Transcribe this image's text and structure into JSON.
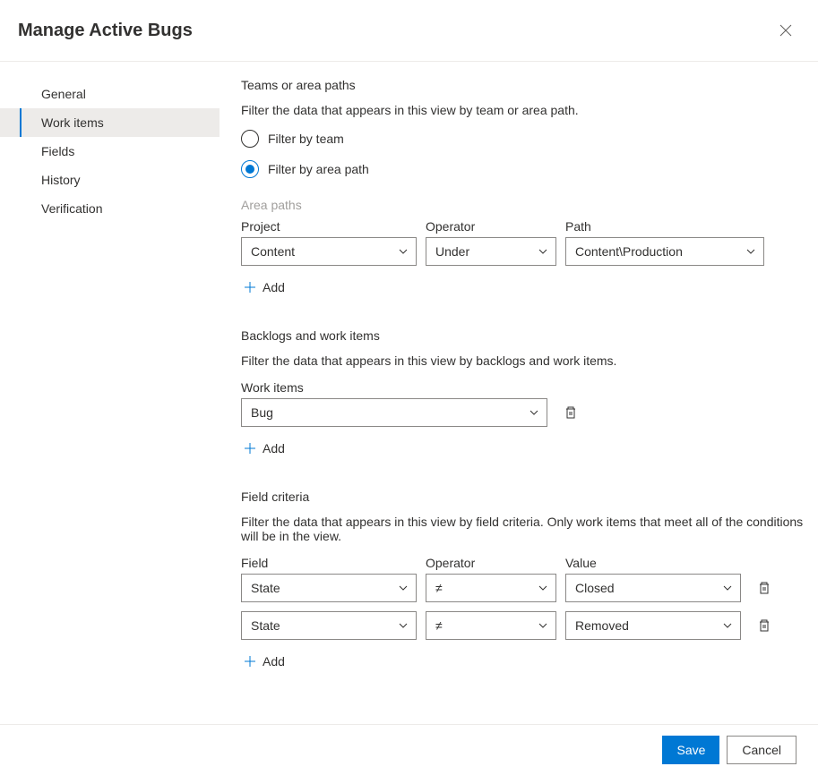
{
  "title": "Manage Active Bugs",
  "sidebar": {
    "items": [
      {
        "label": "General",
        "selected": false
      },
      {
        "label": "Work items",
        "selected": true
      },
      {
        "label": "Fields",
        "selected": false
      },
      {
        "label": "History",
        "selected": false
      },
      {
        "label": "Verification",
        "selected": false
      }
    ]
  },
  "teams_section": {
    "title": "Teams or area paths",
    "desc": "Filter the data that appears in this view by team or area path.",
    "radio_team": "Filter by team",
    "radio_area": "Filter by area path",
    "selected": "area",
    "area_label": "Area paths",
    "project_label": "Project",
    "operator_label": "Operator",
    "path_label": "Path",
    "project_value": "Content",
    "operator_value": "Under",
    "path_value": "Content\\Production",
    "add_label": "Add"
  },
  "backlogs_section": {
    "title": "Backlogs and work items",
    "desc": "Filter the data that appears in this view by backlogs and work items.",
    "work_items_label": "Work items",
    "work_item_value": "Bug",
    "add_label": "Add"
  },
  "criteria_section": {
    "title": "Field criteria",
    "desc": "Filter the data that appears in this view by field criteria. Only work items that meet all of the conditions will be in the view.",
    "field_label": "Field",
    "operator_label": "Operator",
    "value_label": "Value",
    "rows": [
      {
        "field": "State",
        "operator": "≠",
        "value": "Closed"
      },
      {
        "field": "State",
        "operator": "≠",
        "value": "Removed"
      }
    ],
    "add_label": "Add"
  },
  "footer": {
    "save": "Save",
    "cancel": "Cancel"
  }
}
